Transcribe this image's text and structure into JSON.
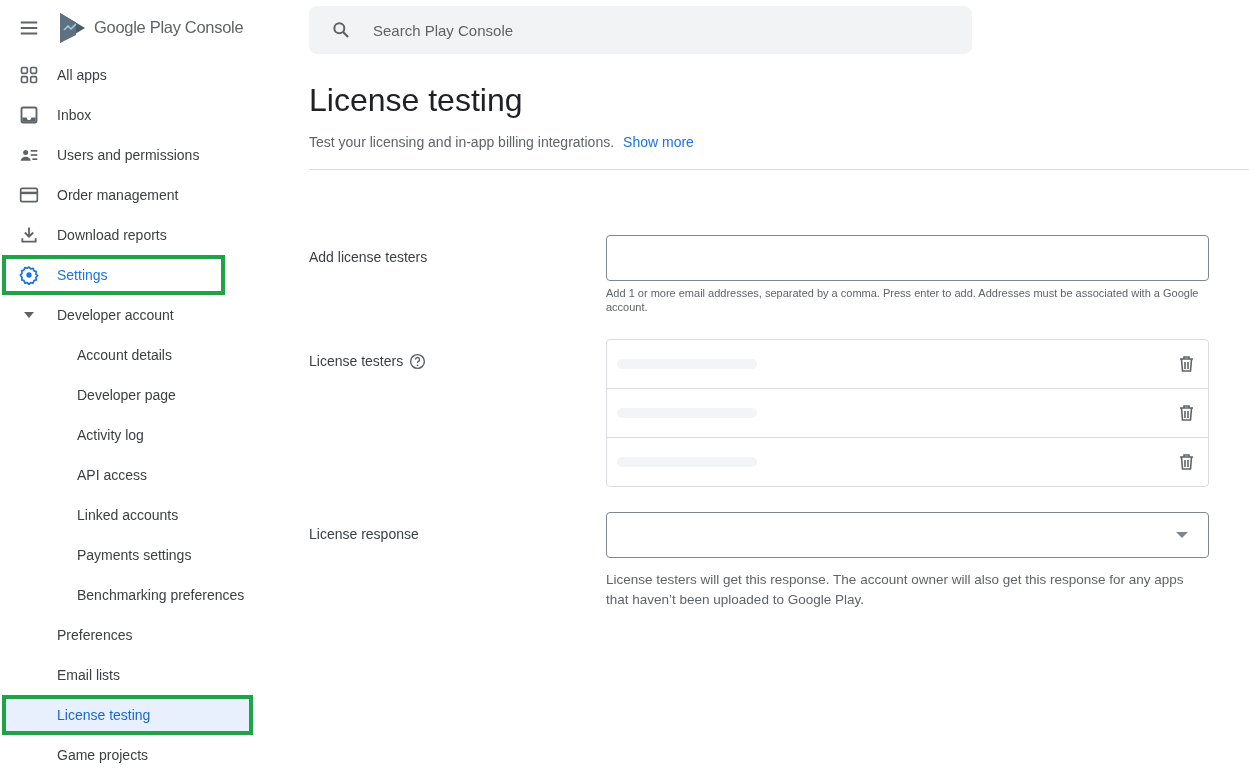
{
  "header": {
    "product": "Google Play Console"
  },
  "search": {
    "placeholder": "Search Play Console"
  },
  "nav": [
    {
      "label": "All apps",
      "kind": "apps",
      "selected": false,
      "highlighted": false
    },
    {
      "label": "Inbox",
      "kind": "inbox",
      "selected": false,
      "highlighted": false
    },
    {
      "label": "Users and permissions",
      "kind": "users",
      "selected": false,
      "highlighted": false
    },
    {
      "label": "Order management",
      "kind": "card",
      "selected": false,
      "highlighted": false
    },
    {
      "label": "Download reports",
      "kind": "download",
      "selected": false,
      "highlighted": false
    },
    {
      "label": "Settings",
      "kind": "settings",
      "selected": false,
      "highlighted": true,
      "active": true,
      "children": [
        {
          "label": "Developer account",
          "selected": false,
          "highlighted": false,
          "expanded": true,
          "children": [
            {
              "label": "Account details",
              "selected": false,
              "highlighted": false
            },
            {
              "label": "Developer page",
              "selected": false,
              "highlighted": false
            },
            {
              "label": "Activity log",
              "selected": false,
              "highlighted": false
            },
            {
              "label": "API access",
              "selected": false,
              "highlighted": false
            },
            {
              "label": "Linked accounts",
              "selected": false,
              "highlighted": false
            },
            {
              "label": "Payments settings",
              "selected": false,
              "highlighted": false
            },
            {
              "label": "Benchmarking preferences",
              "selected": false,
              "highlighted": false
            }
          ]
        },
        {
          "label": "Preferences",
          "selected": false,
          "highlighted": false
        },
        {
          "label": "Email lists",
          "selected": false,
          "highlighted": false
        },
        {
          "label": "License testing",
          "selected": true,
          "highlighted": true
        },
        {
          "label": "Game projects",
          "selected": false,
          "highlighted": false
        }
      ]
    }
  ],
  "page": {
    "title": "License testing",
    "subtitle": "Test your licensing and in-app billing integrations.",
    "link": "Show more"
  },
  "form": [
    {
      "kind": "input",
      "label": "Add license testers",
      "help": "Add 1 or more email addresses, separated by a comma. Press enter to add. Addresses must be associated with a Google account."
    },
    {
      "kind": "list",
      "label": "License testers",
      "rows": [
        {
          "kind": "redacted"
        },
        {
          "kind": "redacted"
        },
        {
          "kind": "redacted"
        }
      ]
    },
    {
      "kind": "select",
      "label": "License response",
      "help": "License testers will get this response. The account owner will also get this response for any apps that haven’t been uploaded to Google Play."
    }
  ]
}
